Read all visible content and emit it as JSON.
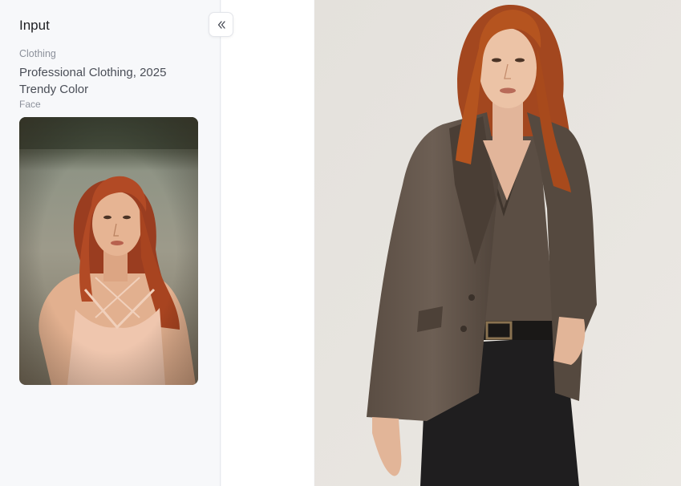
{
  "panel": {
    "title": "Input",
    "collapse_icon": "double-chevron-left-icon"
  },
  "clothing": {
    "label": "Clothing",
    "value": "Professional Clothing, 2025 Trendy Color"
  },
  "face": {
    "label": "Face",
    "image": "portrait of red-haired woman in pink halter dress by water"
  },
  "result": {
    "image": "red-haired woman in brown blazer, brown v-neck top and black trousers against light wall"
  },
  "colors": {
    "sidebar_bg": "#f7f8fa",
    "middle_bg": "#ffffff",
    "text_primary": "#1e1f23",
    "text_muted": "#8c919b",
    "text_value": "#4a4e57"
  }
}
